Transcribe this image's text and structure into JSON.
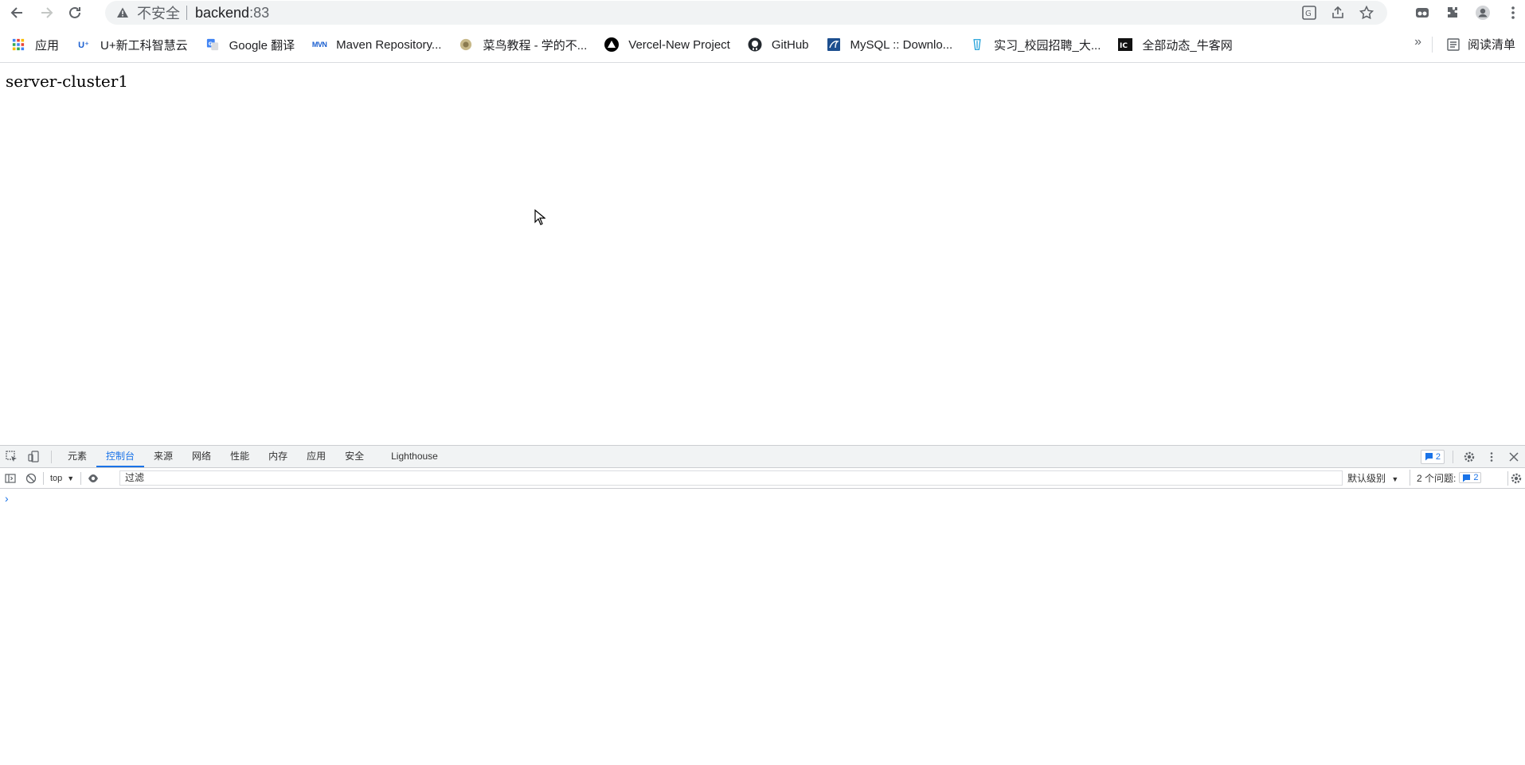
{
  "browser": {
    "omnibox": {
      "security_label": "不安全",
      "url_host": "backend",
      "url_port": ":83"
    }
  },
  "bookmarks": {
    "items": [
      {
        "label": "应用",
        "icon": "apps-grid-icon"
      },
      {
        "label": "U+新工科智慧云",
        "icon": "uplus-icon"
      },
      {
        "label": "Google 翻译",
        "icon": "google-translate-icon"
      },
      {
        "label": "Maven Repository...",
        "icon": "mvn-icon"
      },
      {
        "label": "菜鸟教程 - 学的不...",
        "icon": "runoob-icon"
      },
      {
        "label": "Vercel-New Project",
        "icon": "vercel-icon"
      },
      {
        "label": "GitHub",
        "icon": "github-icon"
      },
      {
        "label": "MySQL :: Downlo...",
        "icon": "mysql-icon"
      },
      {
        "label": "实习_校园招聘_大...",
        "icon": "shixi-icon"
      },
      {
        "label": "全部动态_牛客网",
        "icon": "nowcoder-icon"
      }
    ],
    "more": "»",
    "reading_list": "阅读清单"
  },
  "page": {
    "body_text": "server-cluster1"
  },
  "devtools": {
    "tabs": [
      {
        "label": "元素",
        "active": false
      },
      {
        "label": "控制台",
        "active": true
      },
      {
        "label": "来源",
        "active": false
      },
      {
        "label": "网络",
        "active": false
      },
      {
        "label": "性能",
        "active": false
      },
      {
        "label": "内存",
        "active": false
      },
      {
        "label": "应用",
        "active": false
      },
      {
        "label": "安全",
        "active": false
      },
      {
        "label": "Lighthouse",
        "active": false
      }
    ],
    "issues_badge": "2",
    "console": {
      "context": "top",
      "filter_placeholder": "过滤",
      "level": "默认级别",
      "issues_label": "2 个问题:",
      "issues_count": "2",
      "prompt": "›"
    }
  },
  "colors": {
    "accent": "#1a73e8",
    "toolbar_bg": "#f1f3f4"
  }
}
